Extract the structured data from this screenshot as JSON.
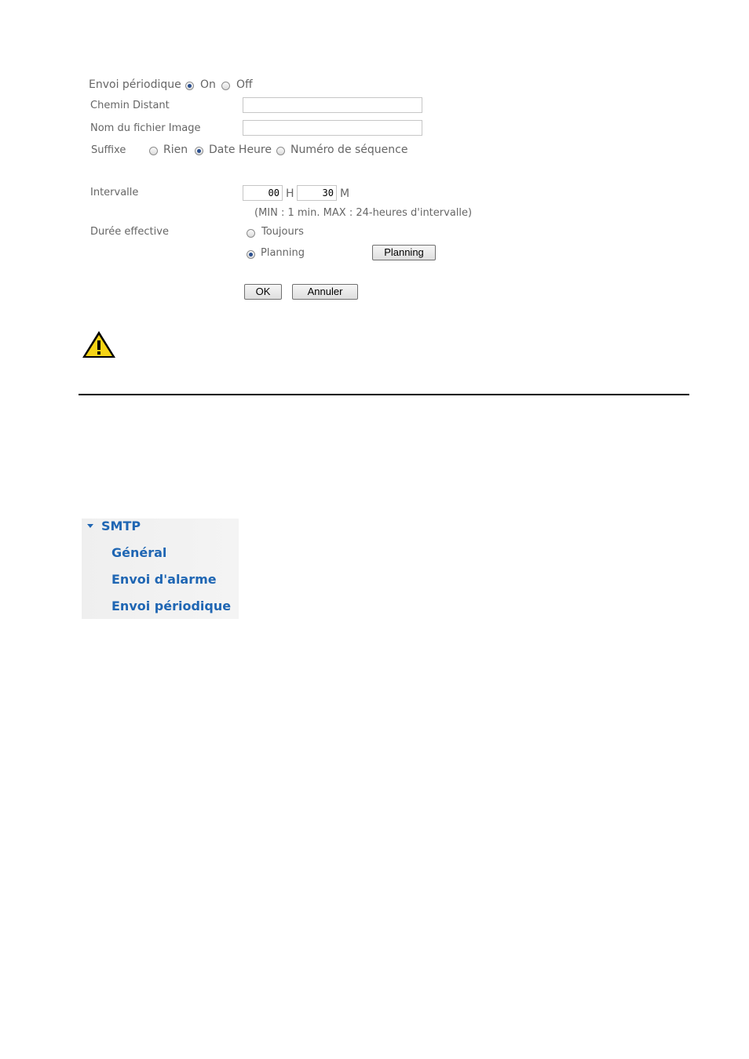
{
  "form": {
    "periodic_label": "Envoi périodique",
    "periodic_on": "On",
    "periodic_off": "Off",
    "periodic_selected": "On",
    "remote_path_label": "Chemin Distant",
    "remote_path_value": "",
    "image_name_label": "Nom du fichier Image",
    "image_name_value": "",
    "suffix_label": "Suffixe",
    "suffix_options": [
      "Rien",
      "Date Heure",
      "Numéro de séquence"
    ],
    "suffix_selected": "Date Heure",
    "interval_label": "Intervalle",
    "interval_hours": "00",
    "interval_hours_unit": "H",
    "interval_minutes": "30",
    "interval_minutes_unit": "M",
    "interval_hint": "(MIN : 1 min. MAX : 24-heures d'intervalle)",
    "duration_label": "Durée effective",
    "duration_always": "Toujours",
    "duration_planning": "Planning",
    "duration_selected": "Planning",
    "planning_button": "Planning",
    "ok_button": "OK",
    "cancel_button": "Annuler"
  },
  "warning_icon": "warning-triangle-icon",
  "menu": {
    "section": "SMTP",
    "items": [
      "Général",
      "Envoi d'alarme",
      "Envoi périodique"
    ]
  },
  "colors": {
    "menu_link": "#1f66b3",
    "label": "#666666"
  }
}
